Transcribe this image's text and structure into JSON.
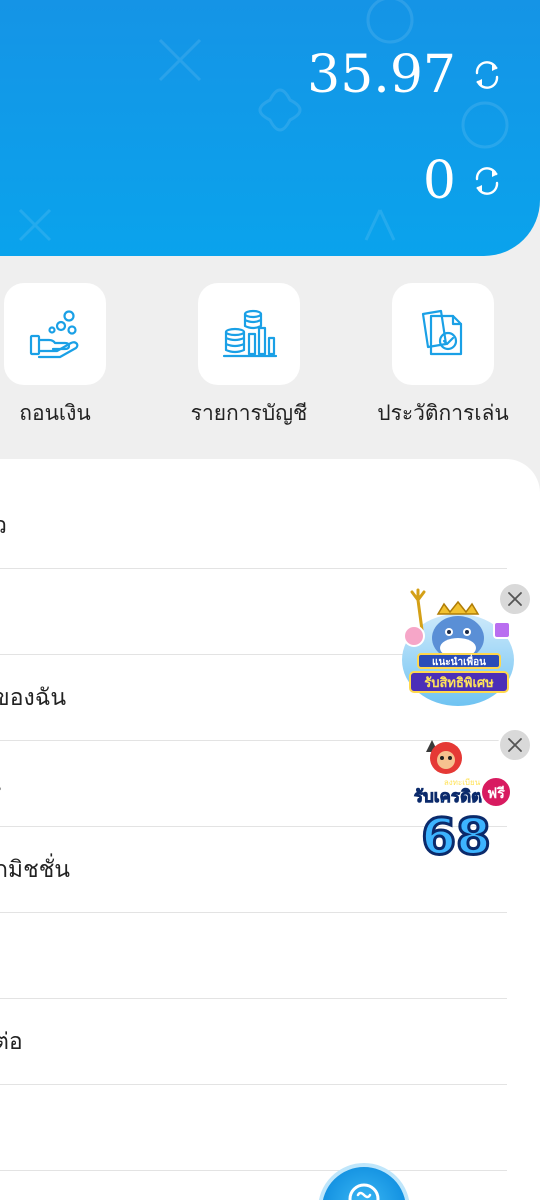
{
  "balances": {
    "main": "35.97",
    "secondary": "0"
  },
  "actions": [
    {
      "label": "ถอนเงิน",
      "icon": "withdraw-coins-hand-icon"
    },
    {
      "label": "รายการบัญชี",
      "icon": "coin-stack-chart-icon"
    },
    {
      "label": "ประวัติการเล่น",
      "icon": "documents-clock-icon"
    }
  ],
  "menu": {
    "items": [
      {
        "label": "ว"
      },
      {
        "label": ""
      },
      {
        "label": "ของฉัน"
      },
      {
        "label": "เ"
      },
      {
        "label": "ักมิชชั่น"
      },
      {
        "label": ""
      },
      {
        "label": "ต่อ"
      },
      {
        "label": ""
      }
    ]
  },
  "promos": {
    "first": {
      "text_line1": "แนะนำเพื่อน",
      "text_line2": "รับสิทธิพิเศษ"
    },
    "second": {
      "text_small": "ลงทะเบียน",
      "text_line1": "รับเครดิต",
      "text_badge": "ฟรี",
      "text_number": "68"
    }
  },
  "colors": {
    "header": "#1594e6",
    "accent": "#1aa0e6"
  },
  "icons": {
    "refresh": "refresh-icon",
    "close": "close-icon",
    "fab": "chat-support-icon"
  }
}
